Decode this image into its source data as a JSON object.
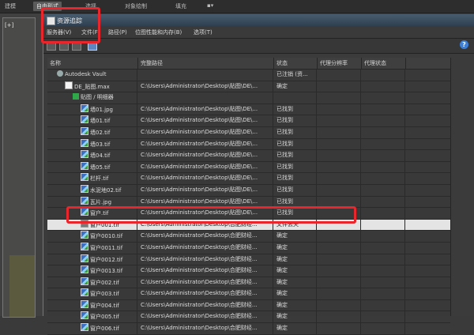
{
  "app_menu": {
    "items": [
      "建模",
      "自由形式",
      "选择",
      "对象绘制",
      "填充",
      "▪▾"
    ],
    "active_index": 1
  },
  "viewport": {
    "label": "[+]"
  },
  "dialog": {
    "title": "资源追踪",
    "menu": [
      "服务器(V)",
      "文件(F)",
      "路径(P)",
      "位图性能和内存(B)",
      "选项(T)"
    ],
    "help_label": "?",
    "columns": [
      "名称",
      "完整路径",
      "状态",
      "代理分辨率",
      "代理状态"
    ]
  },
  "rows": [
    {
      "name": "Autodesk Vault",
      "path": "",
      "status": "已注销 (资...",
      "icon": "vault-icon",
      "indent": 1
    },
    {
      "name": "DE_贴图.max",
      "path": "C:\\Users\\Administrator\\Desktop\\贴图\\DE\\...",
      "status": "确定",
      "icon": "max-file-icon",
      "indent": 2
    },
    {
      "name": "贴图 / 明细器",
      "path": "",
      "status": "",
      "icon": "folder-icon",
      "indent": 3
    },
    {
      "name": "墙01.jpg",
      "path": "C:\\Users\\Administrator\\Desktop\\贴图\\DE\\...",
      "status": "已找到",
      "icon": "image-file-icon",
      "indent": 4
    },
    {
      "name": "墙01.tif",
      "path": "C:\\Users\\Administrator\\Desktop\\贴图\\DE\\...",
      "status": "已找到",
      "icon": "image-file-icon",
      "indent": 4
    },
    {
      "name": "墙02.tif",
      "path": "C:\\Users\\Administrator\\Desktop\\贴图\\DE\\...",
      "status": "已找到",
      "icon": "image-file-icon",
      "indent": 4
    },
    {
      "name": "墙03.tif",
      "path": "C:\\Users\\Administrator\\Desktop\\贴图\\DE\\...",
      "status": "已找到",
      "icon": "image-file-icon",
      "indent": 4
    },
    {
      "name": "墙04.tif",
      "path": "C:\\Users\\Administrator\\Desktop\\贴图\\DE\\...",
      "status": "已找到",
      "icon": "image-file-icon",
      "indent": 4
    },
    {
      "name": "墙05.tif",
      "path": "C:\\Users\\Administrator\\Desktop\\贴图\\DE\\...",
      "status": "已找到",
      "icon": "image-file-icon",
      "indent": 4
    },
    {
      "name": "栏杆.tif",
      "path": "C:\\Users\\Administrator\\Desktop\\贴图\\DE\\...",
      "status": "已找到",
      "icon": "image-file-icon",
      "indent": 4
    },
    {
      "name": "水泥地02.tif",
      "path": "C:\\Users\\Administrator\\Desktop\\贴图\\DE\\...",
      "status": "已找到",
      "icon": "image-file-icon",
      "indent": 4
    },
    {
      "name": "瓦片.jpg",
      "path": "C:\\Users\\Administrator\\Desktop\\贴图\\DE\\...",
      "status": "已找到",
      "icon": "image-file-icon",
      "indent": 4
    },
    {
      "name": "窗户.tif",
      "path": "C:\\Users\\Administrator\\Desktop\\贴图\\DE\\...",
      "status": "已找到",
      "icon": "image-file-icon",
      "indent": 4
    },
    {
      "name": "窗户001.tif",
      "path": "C:\\Users\\Administrator\\Desktop\\合肥财经...",
      "status": "文件丢失",
      "icon": "missing-file-icon",
      "indent": 4,
      "highlight": true
    },
    {
      "name": "窗户0010.tif",
      "path": "C:\\Users\\Administrator\\Desktop\\合肥财经...",
      "status": "确定",
      "icon": "image-file-icon",
      "indent": 4
    },
    {
      "name": "窗户0011.tif",
      "path": "C:\\Users\\Administrator\\Desktop\\合肥财经...",
      "status": "确定",
      "icon": "image-file-icon",
      "indent": 4
    },
    {
      "name": "窗户0012.tif",
      "path": "C:\\Users\\Administrator\\Desktop\\合肥财经...",
      "status": "确定",
      "icon": "image-file-icon",
      "indent": 4
    },
    {
      "name": "窗户0013.tif",
      "path": "C:\\Users\\Administrator\\Desktop\\合肥财经...",
      "status": "确定",
      "icon": "image-file-icon",
      "indent": 4
    },
    {
      "name": "窗户002.tif",
      "path": "C:\\Users\\Administrator\\Desktop\\合肥财经...",
      "status": "确定",
      "icon": "image-file-icon",
      "indent": 4
    },
    {
      "name": "窗户003.tif",
      "path": "C:\\Users\\Administrator\\Desktop\\合肥财经...",
      "status": "确定",
      "icon": "image-file-icon",
      "indent": 4
    },
    {
      "name": "窗户004.tif",
      "path": "C:\\Users\\Administrator\\Desktop\\合肥财经...",
      "status": "确定",
      "icon": "image-file-icon",
      "indent": 4
    },
    {
      "name": "窗户005.tif",
      "path": "C:\\Users\\Administrator\\Desktop\\合肥财经...",
      "status": "确定",
      "icon": "image-file-icon",
      "indent": 4
    },
    {
      "name": "窗户006.tif",
      "path": "C:\\Users\\Administrator\\Desktop\\合肥财经...",
      "status": "确定",
      "icon": "image-file-icon",
      "indent": 4
    }
  ],
  "colors": {
    "highlight_row": "#e4e4e4",
    "annotation_red": "#e8262b",
    "title_bar": "#3a4e60"
  }
}
